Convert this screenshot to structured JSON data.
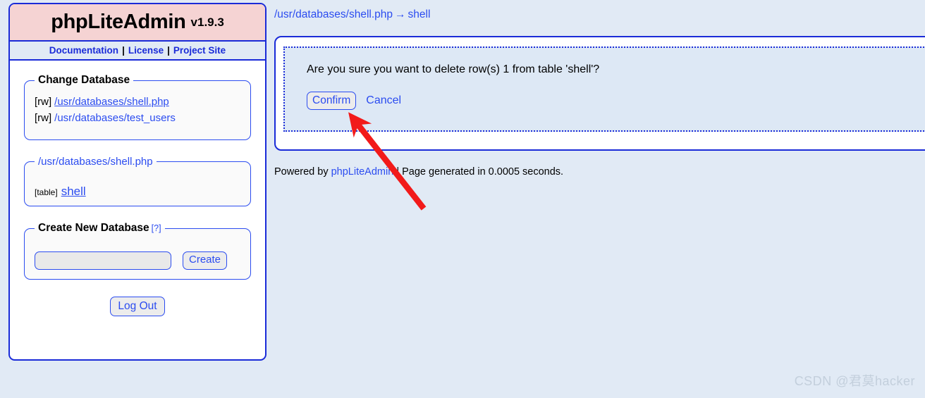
{
  "page": {
    "background_color": "#e1eaf5",
    "accent_color": "#2b4cf0",
    "header_color": "#f5d3d3"
  },
  "sidebar": {
    "brand": {
      "name": "phpLiteAdmin",
      "version": "v1.9.3"
    },
    "nav": {
      "documentation": "Documentation",
      "separator": "|",
      "license": "License",
      "project_site": "Project Site"
    },
    "change_database": {
      "legend": "Change Database",
      "databases": [
        {
          "tag": "[rw]",
          "path": "/usr/databases/shell.php",
          "active": true
        },
        {
          "tag": "[rw]",
          "path": "/usr/databases/test_users",
          "active": false
        }
      ]
    },
    "current_database": {
      "legend": "/usr/databases/shell.php",
      "tables": [
        {
          "tag": "[table]",
          "name": "shell"
        }
      ]
    },
    "create_database": {
      "legend": "Create New Database",
      "help": "[?]",
      "input_value": "",
      "input_placeholder": "",
      "create_label": "Create"
    },
    "logout_label": "Log Out"
  },
  "main": {
    "breadcrumb": {
      "database": "/usr/databases/shell.php",
      "arrow": "→",
      "table": "shell"
    },
    "confirm": {
      "message": "Are you sure you want to delete row(s) 1 from table 'shell'?",
      "confirm_label": "Confirm",
      "cancel_label": "Cancel"
    },
    "footer": {
      "powered_by": "Powered by",
      "app_link": "phpLiteAdmin",
      "separator": "|",
      "generated": "Page generated in 0.0005 seconds."
    }
  },
  "annotation": {
    "arrow_color": "#f21a1a"
  },
  "watermark": "CSDN @君莫hacker"
}
